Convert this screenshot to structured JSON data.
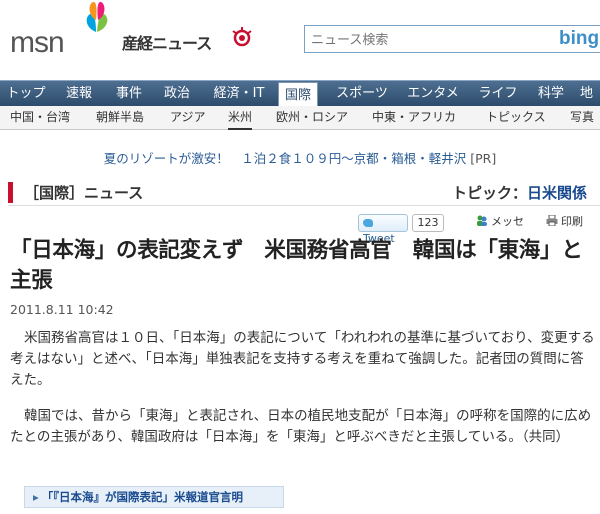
{
  "header": {
    "msn": "msn",
    "sankei": "産経ニュース",
    "search_placeholder": "ニュース検索",
    "bing": "bing"
  },
  "nav_primary": [
    {
      "label": "トップ"
    },
    {
      "label": "速報"
    },
    {
      "label": "事件"
    },
    {
      "label": "政治"
    },
    {
      "label": "経済・IT"
    },
    {
      "label": "国際",
      "active": true
    },
    {
      "label": "スポーツ"
    },
    {
      "label": "エンタメ"
    },
    {
      "label": "ライフ"
    },
    {
      "label": "科学"
    },
    {
      "label": "地"
    }
  ],
  "nav_secondary": [
    {
      "label": "中国・台湾"
    },
    {
      "label": "朝鮮半島"
    },
    {
      "label": "アジア"
    },
    {
      "label": "米州",
      "active": true
    },
    {
      "label": "欧州・ロシア"
    },
    {
      "label": "中東・アフリカ"
    },
    {
      "label": "トピックス"
    },
    {
      "label": "写真"
    }
  ],
  "pr": {
    "text": "夏のリゾートが激安！　１泊２食１０９円～京都・箱根・軽井沢",
    "tag": "[PR]"
  },
  "section": {
    "title": "［国際］ニュース",
    "topic_prefix": "トピック：",
    "topic_link": "日米関係"
  },
  "tools": {
    "tweet": "Tweet",
    "tweet_count": "123",
    "mail": "メッセ",
    "print": "印刷"
  },
  "article": {
    "headline": "「日本海」の表記変えず　米国務省高官　韓国は「東海」と主張",
    "date": "2011.8.11 10:42",
    "paragraphs": [
      "米国務省高官は１０日、「日本海」の表記について「われわれの基準に基づいており、変更する考えはない」と述べ、「日本海」単独表記を支持する考えを重ねて強調した。記者団の質問に答えた。",
      "韓国では、昔から「東海」と表記され、日本の植民地支配が「日本海」の呼称を国際的に広めたとの主張があり、韓国政府は「日本海」を「東海」と呼ぶべきだと主張している。（共同）"
    ],
    "related": "「『日本海』が国際表記」米報道官言明"
  },
  "colors": {
    "nav_primary": "#3a5a7c",
    "accent_red": "#c8102e",
    "link_blue": "#1a4b8f"
  }
}
